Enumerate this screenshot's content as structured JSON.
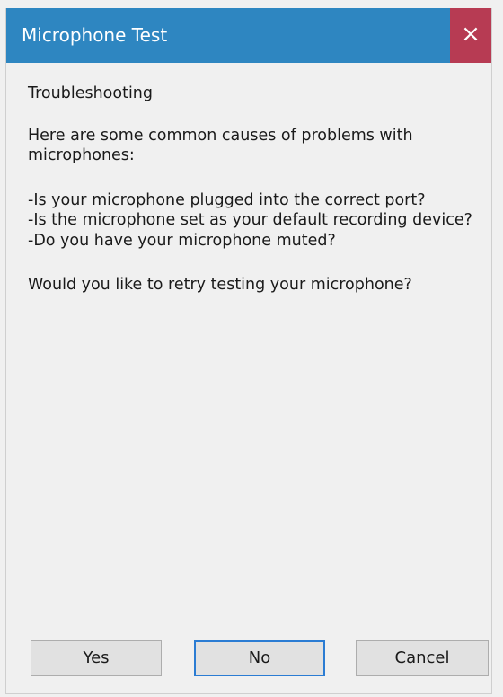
{
  "window": {
    "title": "Microphone Test",
    "close_glyph": "×",
    "colors": {
      "titlebar": "#2e86c1",
      "close_button": "#b73b53",
      "focus_border": "#2b7cd3"
    }
  },
  "content": {
    "heading": "Troubleshooting",
    "intro": "Here are some common causes of problems with microphones:",
    "causes": [
      "-Is your microphone plugged into the correct port?",
      "-Is the microphone set as your default recording device?",
      "-Do you have your microphone muted?"
    ],
    "question": "Would you like to retry testing your microphone?"
  },
  "buttons": {
    "yes": "Yes",
    "no": "No",
    "cancel": "Cancel",
    "focused": "no"
  },
  "icons": {
    "close": "close-icon"
  }
}
